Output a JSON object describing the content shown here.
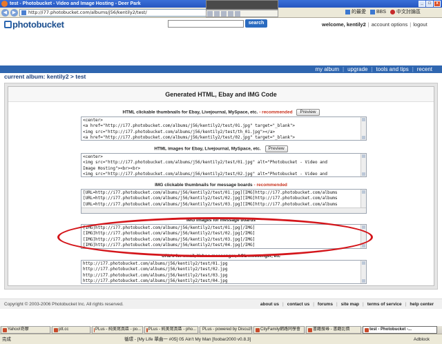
{
  "browser": {
    "window_title": "test - Photobucket - Video and Image Hosting - Deer Park",
    "url": "http://i77.photobucket.com/albums/j56/kentily2/test/",
    "bookmarks": [
      "的最愛",
      "BBS",
      "中文討論區"
    ]
  },
  "site": {
    "logo": "photobucket",
    "search_placeholder": "",
    "search_label": "search",
    "welcome": "welcome, kentily2",
    "account_options": "account options",
    "logout": "logout",
    "nav": [
      "my album",
      "upgrade",
      "tools and tips",
      "recent"
    ],
    "album_prefix": "current album:",
    "album_user": "kentily2",
    "album_arrow": ">",
    "album_name": "test"
  },
  "panel": {
    "title": "Generated HTML, Ebay and IMG Code",
    "preview_label": "Preview",
    "recommended": "- recommended",
    "sections": [
      {
        "label": "HTML clickable thumbnails for Ebay, Livejournal, MySpace, etc.",
        "lines": [
          "<center>",
          "<a href=\"http://i77.photobucket.com/albums/j56/kentily2/test/01.jpg\" target=\"_blank\">",
          "<img src=\"http://i77.photobucket.com/albums/j56/kentily2/test/th_01.jpg\"></a>",
          "<a href=\"http://i77.photobucket.com/albums/j56/kentily2/test/02.jpg\" target=\"_blank\">"
        ]
      },
      {
        "label": "HTML images for Ebay, Livejournal, MySpace, etc.",
        "lines": [
          "<center>",
          "<img src=\"http://i77.photobucket.com/albums/j56/kentily2/test/01.jpg\" alt=\"Photobucket - Video and",
          "Image Hosting\"><br><br>",
          "<img src=\"http://i77.photobucket.com/albums/j56/kentily2/test/02.jpg\" alt=\"Photobucket - Video and"
        ]
      },
      {
        "label": "IMG clickable thumbnails for message boards",
        "lines": [
          "[URL=http://i77.photobucket.com/albums/j56/kentily2/test/01.jpg][IMG]http://i77.photobucket.com/albums",
          "[URL=http://i77.photobucket.com/albums/j56/kentily2/test/02.jpg][IMG]http://i77.photobucket.com/albums",
          "[URL=http://i77.photobucket.com/albums/j56/kentily2/test/03.jpg][IMG]http://i77.photobucket.com/albums"
        ]
      },
      {
        "label": "IMG images for message boards",
        "lines": [
          "[IMG]http://i77.photobucket.com/albums/j56/kentily2/test/01.jpg[/IMG]",
          "[IMG]http://i77.photobucket.com/albums/j56/kentily2/test/02.jpg[/IMG]",
          "[IMG]http://i77.photobucket.com/albums/j56/kentily2/test/03.jpg[/IMG]",
          "[IMG]http://i77.photobucket.com/albums/j56/kentily2/test/04.jpg[/IMG]"
        ]
      },
      {
        "label": "URL's for email, Yahoo messenger, AOL messenger, etc",
        "lines": [
          "http://i77.photobucket.com/albums/j56/kentily2/test/01.jpg",
          "http://i77.photobucket.com/albums/j56/kentily2/test/02.jpg",
          "http://i77.photobucket.com/albums/j56/kentily2/test/03.jpg",
          "http://i77.photobucket.com/albums/j56/kentily2/test/04.jpg"
        ]
      }
    ]
  },
  "footer": {
    "copyright": "Copyright © 2003-2006 Photobucket Inc. All rights reserved.",
    "links": [
      "about us",
      "contact us",
      "forums",
      "site map",
      "terms of service",
      "help center"
    ]
  },
  "taskbar": {
    "items": [
      "Yahoo!奇摩",
      "ptt.cc",
      "PLus - 純美寫真區 - po...",
      "PLus - 純美寫真區 - pho...",
      "PLus - powered by Discuz!",
      "CityFamily網路同學會",
      "書籍搜尋 - 書籍比價",
      "test - Photobucket -..."
    ]
  },
  "status": {
    "text": "完成",
    "song": "循環 - [My Life 單曲一 #05] 05 Ain't My Man   [foobar2000 v0.8.3]",
    "adblock": "Adblock"
  },
  "colors": {
    "accent_blue": "#2f66b0",
    "recommended_red": "#c8301c",
    "highlight_ellipse": "#d4151a"
  }
}
